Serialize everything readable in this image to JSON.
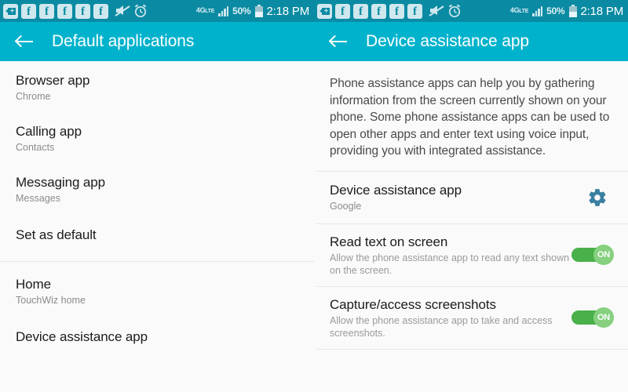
{
  "statusbar": {
    "icons": [
      "app-update-icon",
      "facebook-icon",
      "facebook-icon",
      "facebook-icon",
      "facebook-icon",
      "facebook-icon",
      "mute-icon",
      "alarm-icon"
    ],
    "facebook_glyph": "f",
    "network_label": "4G",
    "network_sub": "LTE",
    "battery_percent": "50%",
    "time": "2:18 PM"
  },
  "left_screen": {
    "appbar": {
      "title": "Default applications",
      "back_label": "back-arrow"
    },
    "items": [
      {
        "title": "Browser app",
        "subtitle": "Chrome"
      },
      {
        "title": "Calling app",
        "subtitle": "Contacts"
      },
      {
        "title": "Messaging app",
        "subtitle": "Messages"
      },
      {
        "title": "Set as default",
        "subtitle": ""
      },
      {
        "title": "Home",
        "subtitle": "TouchWiz home"
      },
      {
        "title": "Device assistance app",
        "subtitle": ""
      }
    ]
  },
  "right_screen": {
    "appbar": {
      "title": "Device assistance app",
      "back_label": "back-arrow"
    },
    "description": "Phone assistance apps can help you by gathering information from the screen currently shown on your phone. Some phone assistance apps can be used to open other apps and enter text using voice input, providing you with integrated assistance.",
    "assistance_row": {
      "title": "Device assistance app",
      "subtitle": "Google",
      "icon": "gear-icon"
    },
    "toggles": [
      {
        "title": "Read text on screen",
        "subtitle": "Allow the phone assistance app to read any text shown on the screen.",
        "state_label": "ON"
      },
      {
        "title": "Capture/access screenshots",
        "subtitle": "Allow the phone assistance app to take and access screenshots.",
        "state_label": "ON"
      }
    ]
  },
  "colors": {
    "statusbar_bg": "#0b8ba3",
    "appbar_bg": "#00b2cc",
    "page_bg": "#fafafa",
    "toggle_on": "#49b04a",
    "toggle_thumb": "#86d07f",
    "gear": "#3b7fa0"
  }
}
